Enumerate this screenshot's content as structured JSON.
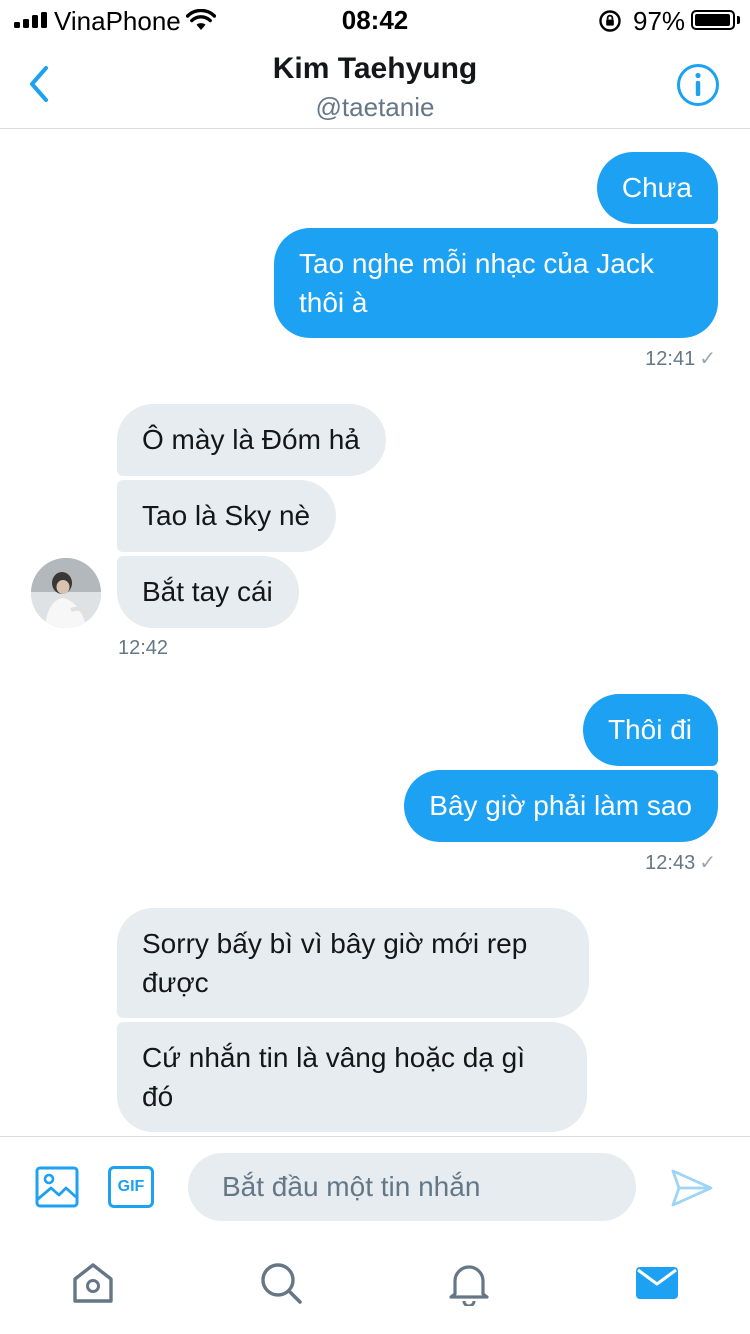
{
  "status_bar": {
    "carrier": "VinaPhone",
    "time": "08:42",
    "battery": "97%",
    "battery_level": 0.97
  },
  "header": {
    "name": "Kim Taehyung",
    "handle": "@taetanie",
    "back_icon": "chevron-left-icon",
    "info_icon": "info-circle-icon"
  },
  "messages": [
    {
      "direction": "out",
      "text": "Chưa"
    },
    {
      "direction": "out",
      "text": "Tao nghe mỗi nhạc của Jack\nthôi à"
    },
    {
      "direction": "out-meta",
      "time": "12:41",
      "status": "✓"
    },
    {
      "direction": "in",
      "text": "Ô mày là Đóm hả"
    },
    {
      "direction": "in",
      "text": "Tao là Sky nè"
    },
    {
      "direction": "in",
      "text": "Bắt tay cái"
    },
    {
      "direction": "in-meta",
      "time": "12:42"
    },
    {
      "direction": "out",
      "text": "Thôi đi"
    },
    {
      "direction": "out",
      "text": "Bây giờ phải làm sao"
    },
    {
      "direction": "out-meta",
      "time": "12:43",
      "status": "✓"
    },
    {
      "direction": "in",
      "text": "Sorry bấy bì vì bây giờ mới rep\nđược"
    },
    {
      "direction": "in",
      "text": "Cứ nhắn tin là vâng hoặc dạ gì\nđó"
    }
  ],
  "composer": {
    "placeholder": "Bắt đầu một tin nhắn",
    "gif_label": "GIF",
    "media_icon": "image-icon",
    "send_icon": "send-icon"
  },
  "tabbar": {
    "items": [
      "home-icon",
      "search-icon",
      "notifications-icon",
      "messages-icon"
    ],
    "active": "messages-icon"
  },
  "colors": {
    "accent": "#1da1f2",
    "incoming_bubble": "#e6ecf0",
    "secondary_text": "#657786",
    "tab_icon": "#657786"
  }
}
